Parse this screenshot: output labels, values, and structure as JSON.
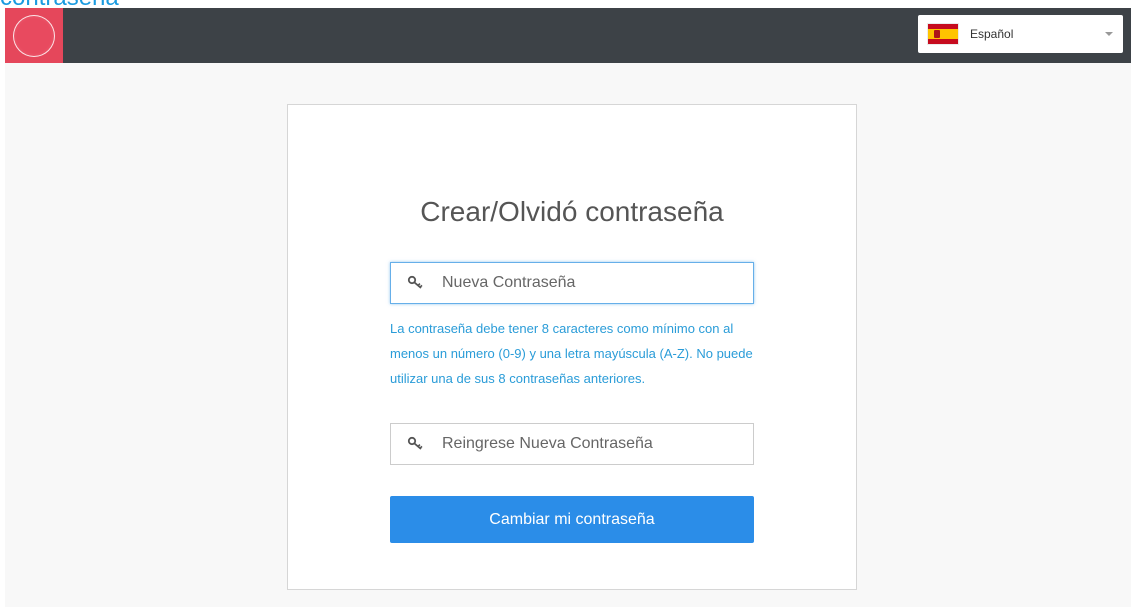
{
  "top_caption": "contraseña",
  "header": {
    "language": {
      "selected": "Español",
      "flag": "spain-flag-icon"
    }
  },
  "form": {
    "title": "Crear/Olvidó contraseña",
    "new_password": {
      "placeholder": "Nueva Contraseña",
      "value": ""
    },
    "help_text": "La contraseña debe tener 8 caracteres como mínimo con al menos un número (0-9) y una letra mayúscula (A-Z). No puede utilizar una de sus 8 contraseñas anteriores.",
    "confirm_password": {
      "placeholder": "Reingrese Nueva Contraseña",
      "value": ""
    },
    "submit_label": "Cambiar mi contraseña"
  },
  "colors": {
    "navbar": "#3d4247",
    "logo": "#e5475b",
    "accent": "#2b8de8",
    "help_text": "#2a9cd8"
  }
}
